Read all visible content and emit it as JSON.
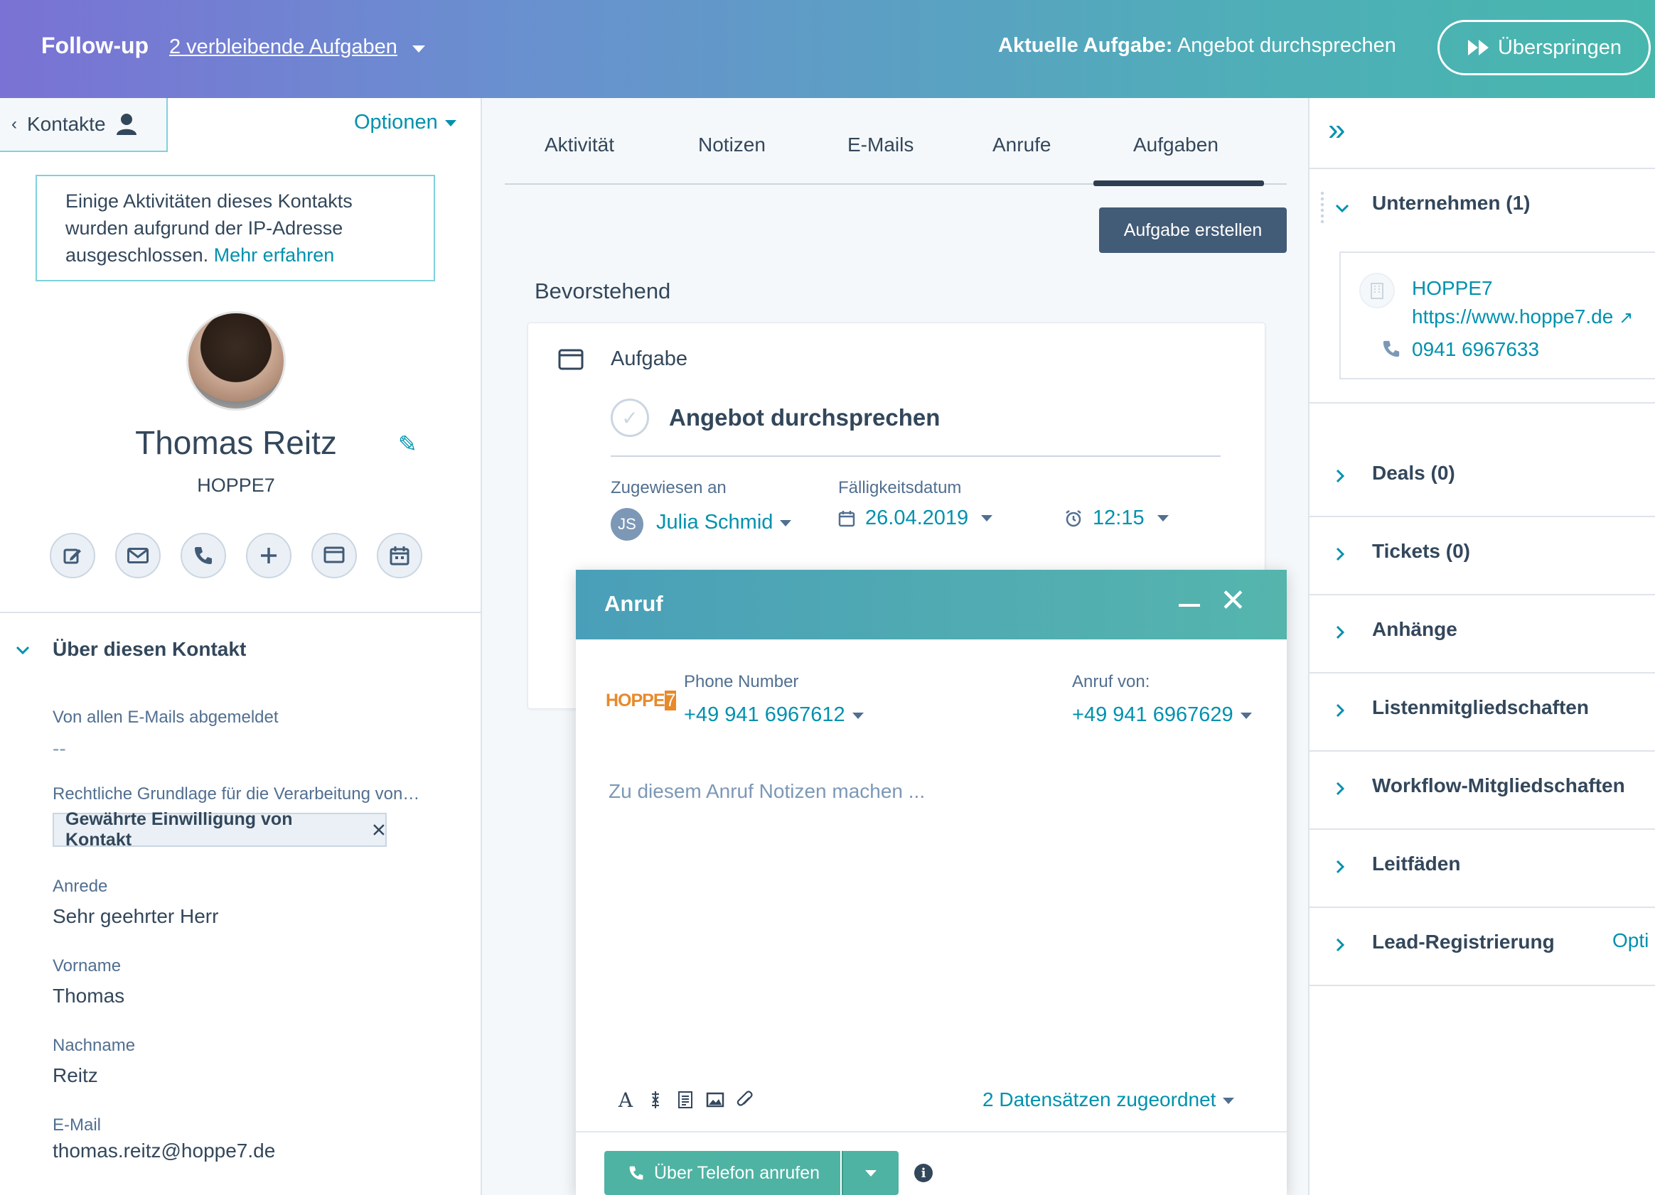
{
  "header": {
    "title": "Follow-up",
    "remaining": "2 verbleibende Aufgaben",
    "current_label": "Aktuelle Aufgabe:",
    "current_task": "Angebot durchsprechen",
    "skip_label": "Überspringen"
  },
  "left": {
    "contacts_label": "Kontakte",
    "options_label": "Optionen",
    "ip_note": {
      "text": "Einige Aktivitäten dieses Kontakts wurden aufgrund der IP-Adresse ausgeschlossen.",
      "link": "Mehr erfahren"
    },
    "name": "Thomas Reitz",
    "company": "HOPPE7",
    "actions": [
      "note-icon",
      "email-icon",
      "phone-icon",
      "add-icon",
      "task-icon",
      "meeting-icon"
    ],
    "about_title": "Über diesen Kontakt",
    "properties": [
      {
        "label": "Von allen E-Mails abgemeldet",
        "value": "--"
      },
      {
        "label": "Rechtliche Grundlage für die Verarbeitung von…",
        "value": "Gewährte Einwilligung von Kontakt"
      },
      {
        "label": "Anrede",
        "value": "Sehr geehrter Herr"
      },
      {
        "label": "Vorname",
        "value": "Thomas"
      },
      {
        "label": "Nachname",
        "value": "Reitz"
      },
      {
        "label": "E-Mail",
        "value": "thomas.reitz@hoppe7.de"
      }
    ]
  },
  "middle": {
    "tabs": [
      "Aktivität",
      "Notizen",
      "E-Mails",
      "Anrufe",
      "Aufgaben"
    ],
    "active_tab": "Aufgaben",
    "create_task": "Aufgabe erstellen",
    "upcoming": "Bevorstehend",
    "task": {
      "type": "Aufgabe",
      "title": "Angebot durchsprechen",
      "assigned_label": "Zugewiesen an",
      "assignee_initials": "JS",
      "assignee": "Julia Schmid",
      "due_label": "Fälligkeitsdatum",
      "due_date": "26.04.2019",
      "due_time": "12:15"
    }
  },
  "call": {
    "title": "Anruf",
    "logo_text": "HOPPE",
    "logo_num": "7",
    "phone_label": "Phone Number",
    "phone_value": "+49 941 6967612",
    "from_label": "Anruf von:",
    "from_value": "+49 941 6967629",
    "notes_placeholder": "Zu diesem Anruf Notizen machen ...",
    "associated": "2 Datensätzen zugeordnet",
    "call_button": "Über Telefon anrufen"
  },
  "right": {
    "sections": [
      {
        "title": "Unternehmen (1)",
        "expanded": true
      },
      {
        "title": "Deals (0)"
      },
      {
        "title": "Tickets (0)"
      },
      {
        "title": "Anhänge"
      },
      {
        "title": "Listenmitgliedschaften"
      },
      {
        "title": "Workflow-Mitgliedschaften"
      },
      {
        "title": "Leitfäden"
      },
      {
        "title": "Lead-Registrierung"
      }
    ],
    "company": {
      "name": "HOPPE7",
      "url": "https://www.hoppe7.de",
      "phone": "0941 6967633"
    },
    "lead_options": "Opti"
  },
  "colors": {
    "accent": "#0091ae",
    "text": "#33475b",
    "call_green": "#4eb3a3",
    "dark_button": "#425b76"
  }
}
